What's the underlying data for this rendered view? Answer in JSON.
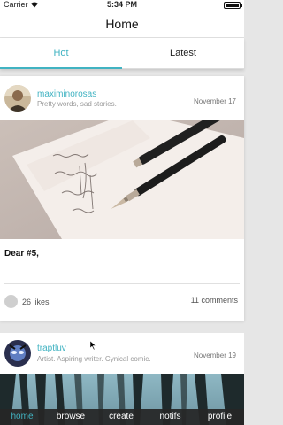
{
  "status_bar": {
    "carrier": "Carrier",
    "time": "5:34 PM",
    "wifi_icon": "wifi-icon",
    "battery_icon": "battery-icon"
  },
  "nav": {
    "title": "Home"
  },
  "tabs": [
    {
      "label": "Hot",
      "active": true
    },
    {
      "label": "Latest",
      "active": false
    }
  ],
  "posts": [
    {
      "username": "maximinorosas",
      "bio": "Pretty words, sad stories.",
      "date": "November 17",
      "title": "Dear #5,",
      "likes": "26 likes",
      "comments": "11 comments"
    },
    {
      "username": "traptluv",
      "bio": "Artist. Aspiring writer. Cynical comic.",
      "date": "November 19"
    }
  ],
  "bottom_nav": [
    {
      "label": "home",
      "active": true
    },
    {
      "label": "browse",
      "active": false
    },
    {
      "label": "create",
      "active": false
    },
    {
      "label": "notifs",
      "active": false
    },
    {
      "label": "profile",
      "active": false
    }
  ],
  "colors": {
    "accent": "#41b3c2",
    "bottom_bar": "#262626",
    "muted": "#9a9a9a"
  }
}
